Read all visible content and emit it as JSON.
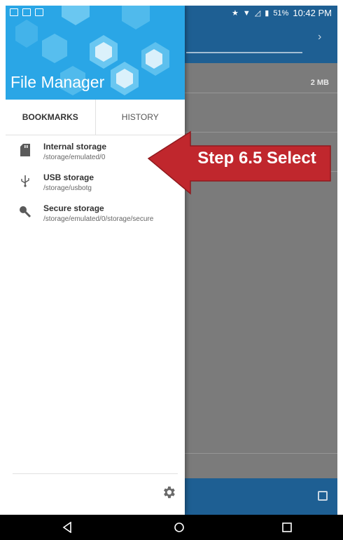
{
  "status_bar": {
    "battery": "51%",
    "time": "10:42 PM"
  },
  "drawer": {
    "title": "File Manager",
    "tabs": [
      {
        "label": "BOOKMARKS",
        "active": true
      },
      {
        "label": "HISTORY",
        "active": false
      }
    ],
    "items": [
      {
        "name": "Internal storage",
        "path": "/storage/emulated/0",
        "icon": "sd-card-icon"
      },
      {
        "name": "USB storage",
        "path": "/storage/usbotg",
        "icon": "usb-icon"
      },
      {
        "name": "Secure storage",
        "path": "/storage/emulated/0/storage/secure",
        "icon": "key-icon"
      }
    ],
    "settings_icon": "gear-icon"
  },
  "background_app": {
    "size_label": "2 MB"
  },
  "callout": {
    "text": "Step 6.5 Select",
    "color": "#c0272d"
  },
  "colors": {
    "drawer_header": "#2aa6e6",
    "app_bar": "#1e5f93"
  },
  "navbar": {
    "buttons": [
      "back-icon",
      "home-icon",
      "recents-icon"
    ]
  }
}
